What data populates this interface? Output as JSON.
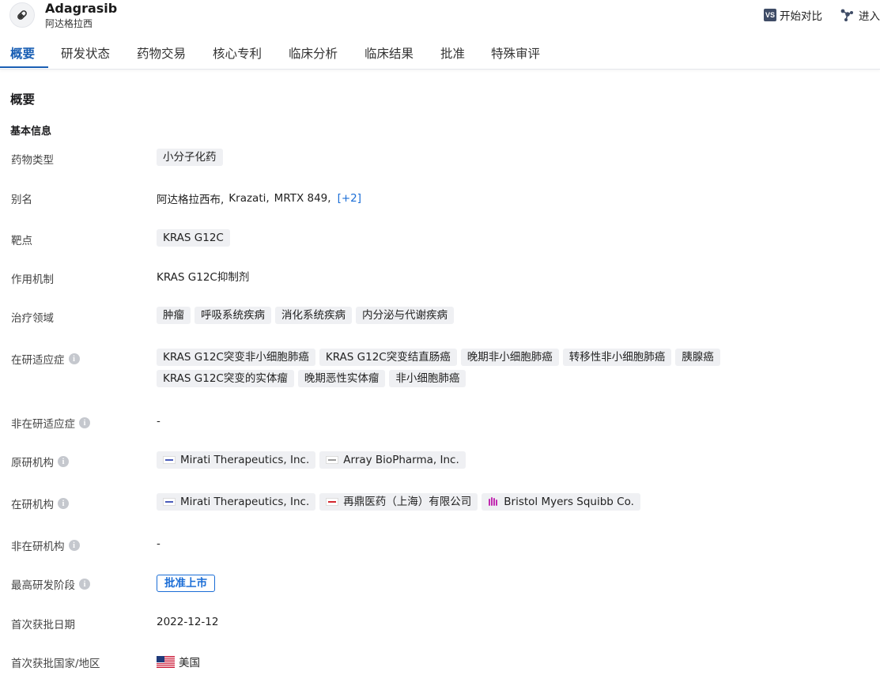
{
  "header": {
    "drug_name": "Adagrasib",
    "drug_name_cn": "阿达格拉西",
    "compare_label": "开始对比",
    "compare_icon_text": "VS",
    "enter_label": "进入"
  },
  "tabs": [
    {
      "label": "概要"
    },
    {
      "label": "研发状态"
    },
    {
      "label": "药物交易"
    },
    {
      "label": "核心专利"
    },
    {
      "label": "临床分析"
    },
    {
      "label": "临床结果"
    },
    {
      "label": "批准"
    },
    {
      "label": "特殊审评"
    }
  ],
  "overview": {
    "title": "概要",
    "basic_info_title": "基本信息",
    "rows": {
      "drug_type": {
        "label": "药物类型",
        "chips": [
          "小分子化药"
        ]
      },
      "alias": {
        "label": "别名",
        "values": [
          "阿达格拉西布,",
          "Krazati,",
          "MRTX 849,"
        ],
        "more": "[+2]"
      },
      "target": {
        "label": "靶点",
        "chips": [
          "KRAS G12C"
        ]
      },
      "mechanism": {
        "label": "作用机制",
        "value": "KRAS G12C抑制剂"
      },
      "therapeutic_area": {
        "label": "治疗领域",
        "chips": [
          "肿瘤",
          "呼吸系统疾病",
          "消化系统疾病",
          "内分泌与代谢疾病"
        ]
      },
      "active_indications": {
        "label": "在研适应症",
        "chips": [
          "KRAS G12C突变非小细胞肺癌",
          "KRAS G12C突变结直肠癌",
          "晚期非小细胞肺癌",
          "转移性非小细胞肺癌",
          "胰腺癌",
          "KRAS G12C突变的实体瘤",
          "晚期恶性实体瘤",
          "非小细胞肺癌"
        ]
      },
      "inactive_indications": {
        "label": "非在研适应症",
        "value": "-"
      },
      "originator": {
        "label": "原研机构",
        "orgs": [
          "Mirati Therapeutics, Inc.",
          "Array BioPharma, Inc."
        ]
      },
      "active_orgs": {
        "label": "在研机构",
        "orgs": [
          "Mirati Therapeutics, Inc.",
          "再鼎医药（上海）有限公司",
          "Bristol Myers Squibb Co."
        ]
      },
      "inactive_orgs": {
        "label": "非在研机构",
        "value": "-"
      },
      "highest_phase": {
        "label": "最高研发阶段",
        "badge": "批准上市"
      },
      "first_approval_date": {
        "label": "首次获批日期",
        "value": "2022-12-12"
      },
      "first_approval_country": {
        "label": "首次获批国家/地区",
        "value": "美国"
      }
    }
  },
  "colors": {
    "accent": "#1a5fb4",
    "link": "#1a6dd6",
    "chip_bg": "#eff0f3"
  }
}
